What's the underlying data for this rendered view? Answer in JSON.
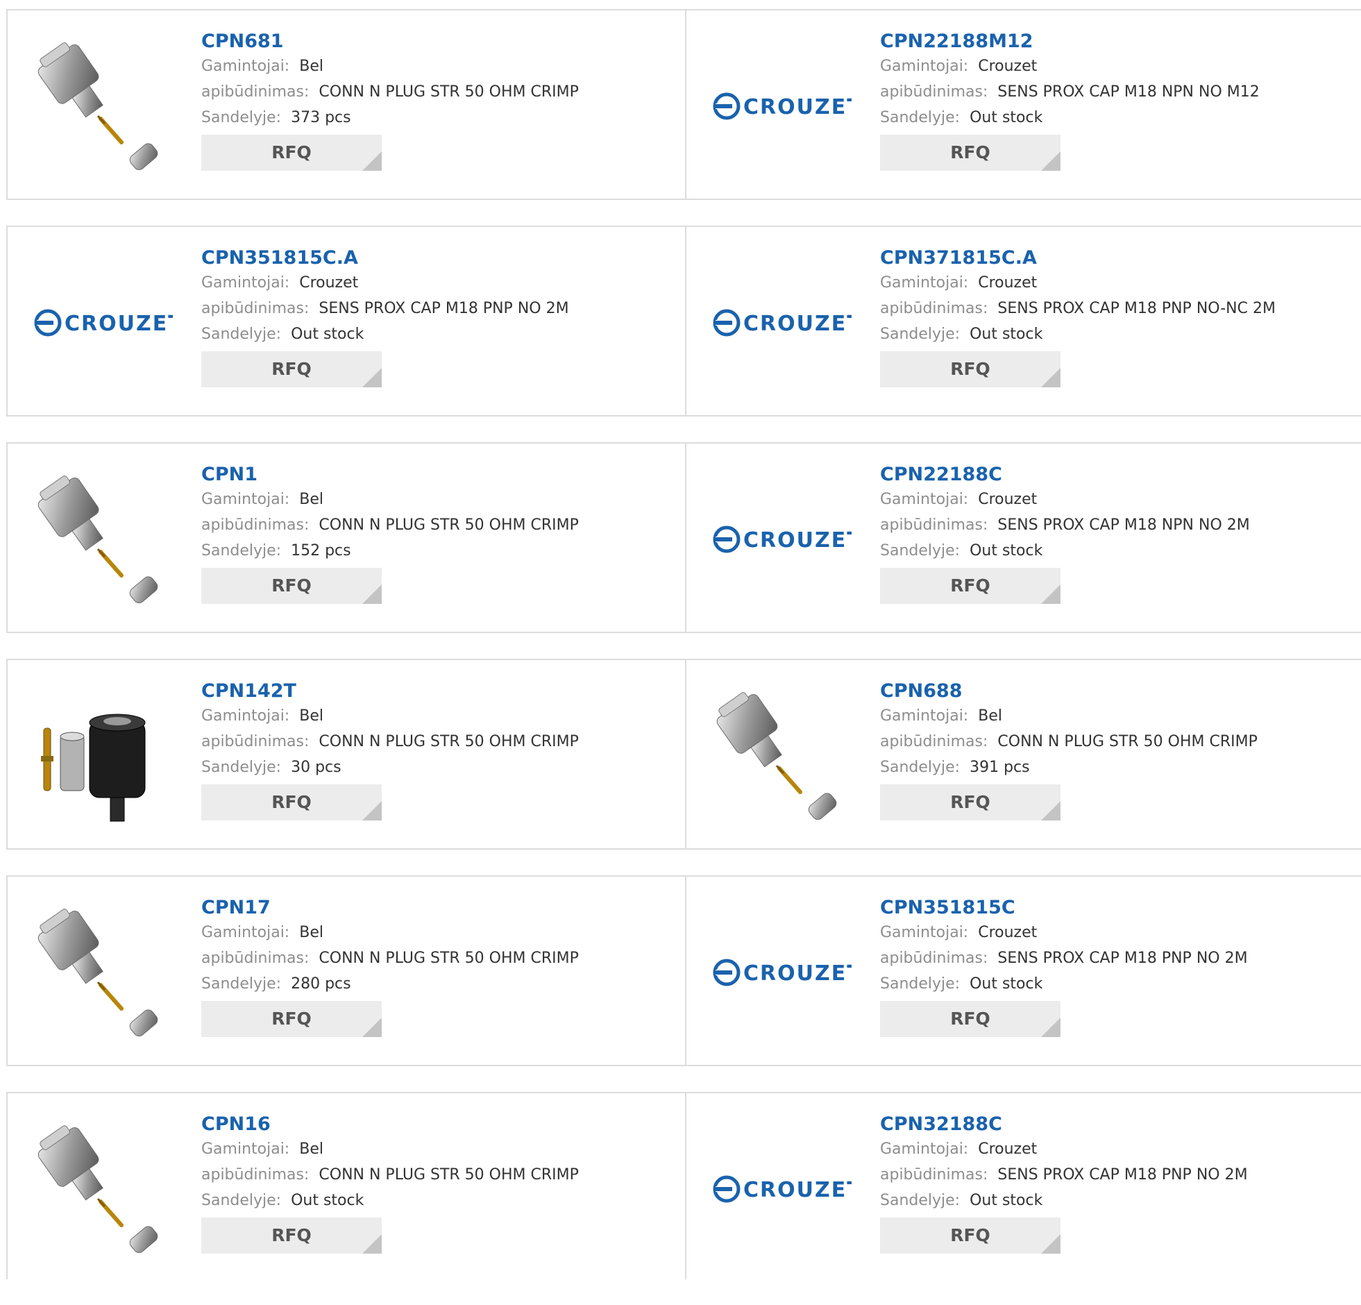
{
  "labels": {
    "manufacturer": "Gamintojai:",
    "description": "apibūdinimas:",
    "stock": "Sandelyje:",
    "rfq": "RFQ"
  },
  "brand_logo_text": "CROUZET",
  "colors": {
    "part_link": "#1a62ad",
    "label": "#8d8d8d",
    "value": "#333333",
    "rfq_bg": "#ececec"
  },
  "products": [
    {
      "part": "CPN681",
      "manufacturer": "Bel",
      "description": "CONN N PLUG STR 50 OHM CRIMP",
      "stock": "373 pcs",
      "image": "n-plug-crimp-connector"
    },
    {
      "part": "CPN22188M12",
      "manufacturer": "Crouzet",
      "description": "SENS PROX CAP M18 NPN NO M12",
      "stock": "Out stock",
      "image": "crouzet-logo"
    },
    {
      "part": "CPN351815C.A",
      "manufacturer": "Crouzet",
      "description": "SENS PROX CAP M18 PNP NO 2M",
      "stock": "Out stock",
      "image": "crouzet-logo"
    },
    {
      "part": "CPN371815C.A",
      "manufacturer": "Crouzet",
      "description": "SENS PROX CAP M18 PNP NO-NC 2M",
      "stock": "Out stock",
      "image": "crouzet-logo"
    },
    {
      "part": "CPN1",
      "manufacturer": "Bel",
      "description": "CONN N PLUG STR 50 OHM CRIMP",
      "stock": "152 pcs",
      "image": "n-plug-crimp-connector"
    },
    {
      "part": "CPN22188C",
      "manufacturer": "Crouzet",
      "description": "SENS PROX CAP M18 NPN NO 2M",
      "stock": "Out stock",
      "image": "crouzet-logo"
    },
    {
      "part": "CPN142T",
      "manufacturer": "Bel",
      "description": "CONN N PLUG STR 50 OHM CRIMP",
      "stock": "30 pcs",
      "image": "n-plug-black-connector"
    },
    {
      "part": "CPN688",
      "manufacturer": "Bel",
      "description": "CONN N PLUG STR 50 OHM CRIMP",
      "stock": "391 pcs",
      "image": "n-plug-crimp-connector"
    },
    {
      "part": "CPN17",
      "manufacturer": "Bel",
      "description": "CONN N PLUG STR 50 OHM CRIMP",
      "stock": "280 pcs",
      "image": "n-plug-crimp-connector"
    },
    {
      "part": "CPN351815C",
      "manufacturer": "Crouzet",
      "description": "SENS PROX CAP M18 PNP NO 2M",
      "stock": "Out stock",
      "image": "crouzet-logo"
    },
    {
      "part": "CPN16",
      "manufacturer": "Bel",
      "description": "CONN N PLUG STR 50 OHM CRIMP",
      "stock": "Out stock",
      "image": "n-plug-crimp-connector"
    },
    {
      "part": "CPN32188C",
      "manufacturer": "Crouzet",
      "description": "SENS PROX CAP M18 PNP NO 2M",
      "stock": "Out stock",
      "image": "crouzet-logo"
    }
  ]
}
